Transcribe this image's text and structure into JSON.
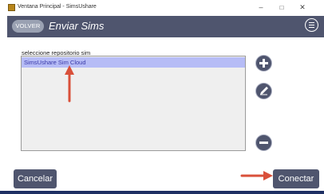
{
  "window": {
    "title": "Ventana Principal - SimsUshare",
    "controls": {
      "minimize": "–",
      "maximize": "□",
      "close": "✕"
    }
  },
  "header": {
    "back_label": "VOLVER",
    "title": "Enviar Sims",
    "menu_icon": "hamburger-menu-icon"
  },
  "main": {
    "list_label": "seleccione repositorio sim",
    "items": [
      "SimsUshare Sim Cloud"
    ],
    "selected_index": 0
  },
  "side_actions": {
    "add_icon": "plus-icon",
    "edit_icon": "pencil-icon",
    "remove_icon": "minus-icon"
  },
  "footer": {
    "cancel_label": "Cancelar",
    "connect_label": "Conectar"
  },
  "colors": {
    "header_bg": "#4f556e",
    "selected_item_bg": "#b6bcf6",
    "selected_item_text": "#3a3aa8",
    "annotation_arrow": "#d9503a"
  }
}
